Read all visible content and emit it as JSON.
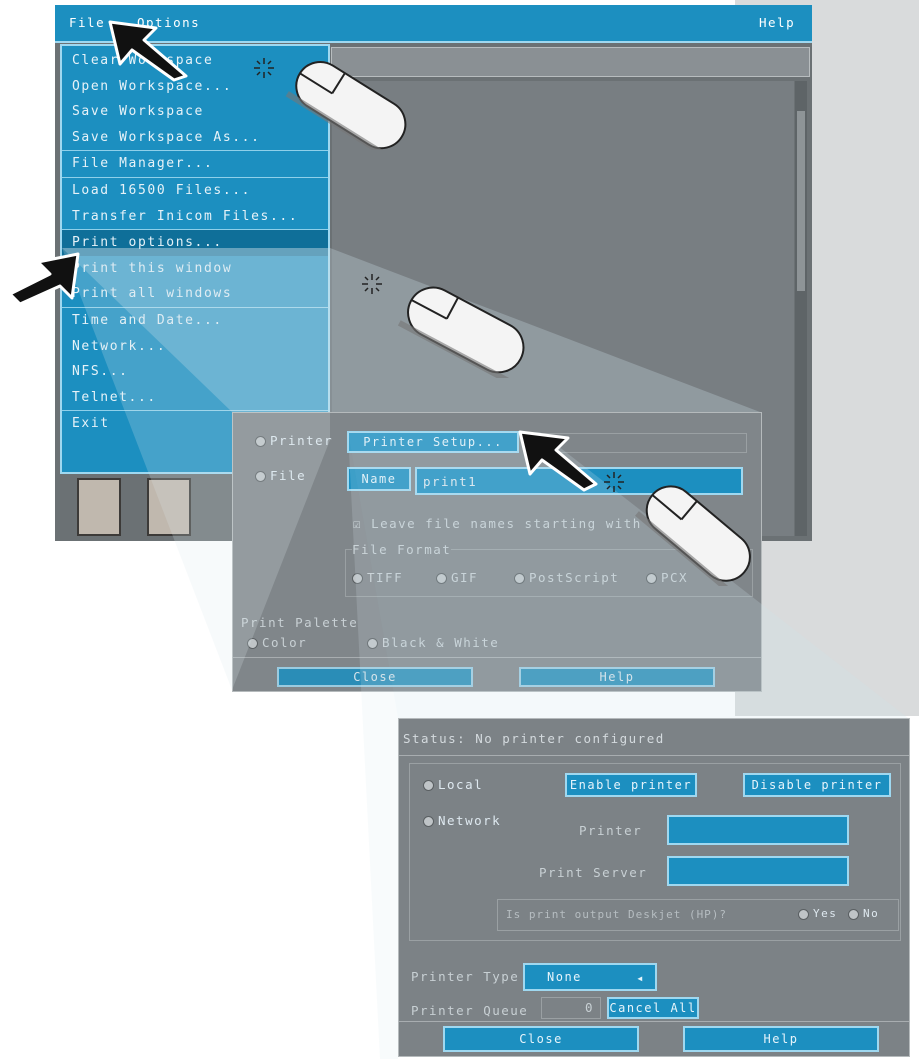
{
  "menubar": {
    "file": "File",
    "options": "Options",
    "help": "Help"
  },
  "file_menu": {
    "items": [
      "Clear Workspace",
      "Open Workspace...",
      "Save Workspace",
      "Save Workspace As...",
      "File Manager...",
      "Load 16500 Files...",
      "Transfer Inicom Files...",
      "Print options...",
      "Print this window",
      "Print all windows",
      "Time and Date...",
      "Network...",
      "NFS...",
      "Telnet...",
      "Exit"
    ],
    "highlighted_index": 7
  },
  "print_options_dialog": {
    "printer_radio": "Printer",
    "printer_setup_button": "Printer Setup...",
    "file_radio": "File",
    "filename_label": "Name",
    "filename_value": "print1",
    "checkbox_label": "Leave file names starting with",
    "file_format_label": "File Format",
    "format_options": [
      "TIFF",
      "GIF",
      "PostScript",
      "PCX"
    ],
    "print_palette_label": "Print Palette",
    "palette_options": [
      "Color",
      "Black & White"
    ],
    "close_button": "Close",
    "help_button": "Help"
  },
  "printer_setup_dialog": {
    "status": "Status: No printer configured",
    "local_radio": "Local",
    "enable_printer_button": "Enable printer",
    "disable_printer_button": "Disable printer",
    "network_radio": "Network",
    "printer_field_label": "Printer",
    "print_server_label": "Print Server",
    "page_output_label": "Is print output Deskjet (HP)?",
    "yes_option": "Yes",
    "no_option": "No",
    "printer_type_label": "Printer Type",
    "printer_type_value": "None",
    "printer_queue_label": "Printer Queue",
    "printer_queue_value": "0",
    "cancel_all_button": "Cancel All",
    "close_button": "Close",
    "help_button": "Help"
  },
  "colors": {
    "menu_blue": "#1c8fc0",
    "panel_gray": "#7c8286",
    "accent_border": "#9fd8f0"
  }
}
